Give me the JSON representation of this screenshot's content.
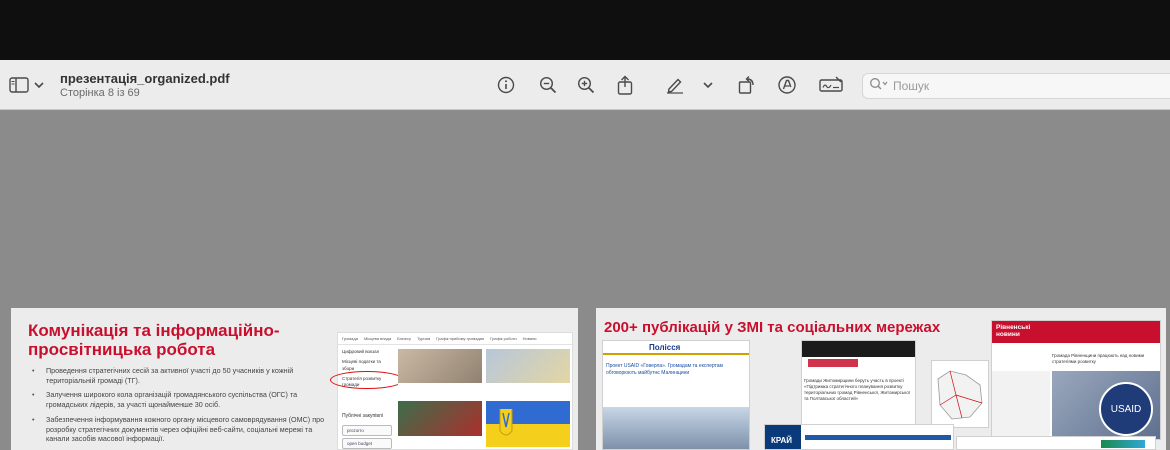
{
  "document": {
    "filename": "презентація_organized.pdf",
    "page_indicator": "Сторінка 8 із 69"
  },
  "toolbar": {
    "icons": [
      "sidebar-icon",
      "chevron-down-icon",
      "info-icon",
      "zoom-out-icon",
      "zoom-in-icon",
      "share-icon",
      "markup-pen-icon",
      "chevron-down-icon",
      "rotate-icon",
      "annotate-icon",
      "signature-icon",
      "search-icon"
    ],
    "search_placeholder": "Пошук"
  },
  "slides": [
    {
      "title": "Комунікація та інформаційно-просвітницька робота",
      "bullets": [
        "Проведення стратегічних сесій за активної участі до 50 учасників у кожній територіальній громаді (ТГ).",
        "Залучення широкого кола організацій громадянського суспільства (ОГС) та громадських лідерів, за участі щонайменше 30 осіб.",
        "Забезпечення інформування кожного органу місцевого самоврядування (ОМС) про розробку стратегічних документів через офіційні веб-сайти, соціальні мережі та канали засобів масової інформації."
      ],
      "website": {
        "nav": [
          "Громада",
          "Місцева влада",
          "Бізнесу",
          "Туризм",
          "Графік прийому громадян",
          "Графік роботи",
          "Новини"
        ],
        "menu": [
          "Цифровий вокзал",
          "Місцеві податки та збори",
          "Стратегія розвитку громади",
          "Публічні закупівлі"
        ],
        "badges": [
          "prozorro",
          "open budget"
        ]
      }
    },
    {
      "title": "200+ публікацій у ЗМІ та соціальних мережах",
      "clips": [
        {
          "name": "Полісся",
          "headline": "Проект USAID «Говерла». Громадам та експертам обговорюють майбутнє Малинщини"
        },
        {
          "name": "Рівненські новини",
          "headline": "Громада Рівненщини працюють над новими стратегіями розвитку"
        },
        {
          "name": "Житомирщина",
          "headline": "Громади Житомирщини беруть участь в проекті «Підтримка стратегічного планування розвитку територіальних громад Рівненської, Житомирської та Полтавської областей»"
        },
        {
          "name": "КРАЙ",
          "headline": ""
        }
      ]
    }
  ],
  "colors": {
    "accent_red": "#c8102e",
    "toolbar_bg": "#ececec",
    "viewer_bg": "#8b8b8b"
  }
}
